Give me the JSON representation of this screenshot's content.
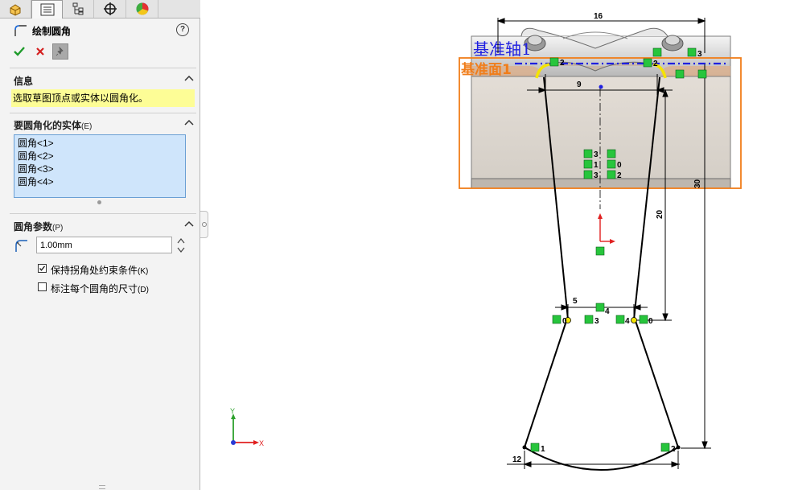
{
  "property_manager": {
    "title": "绘制圆角",
    "help_symbol": "?",
    "info_section": {
      "heading": "信息",
      "message": "选取草图顶点或实体以圆角化。"
    },
    "entities_section": {
      "heading": "要圆角化的实体",
      "hotkey": "(E)",
      "items": [
        "圆角<1>",
        "圆角<2>",
        "圆角<3>",
        "圆角<4>"
      ]
    },
    "params_section": {
      "heading": "圆角参数",
      "hotkey": "(P)",
      "radius_value": "1.00mm",
      "keep_constraints": {
        "label": "保持拐角处约束条件",
        "hotkey": "(K)",
        "checked": true
      },
      "dimension_each": {
        "label": "标注每个圆角的尺寸",
        "hotkey": "(D)",
        "checked": false
      }
    },
    "tabs": [
      "feature-manager-icon",
      "property-manager-icon",
      "configuration-manager-icon",
      "dimxpert-icon",
      "display-manager-icon"
    ]
  },
  "viewport": {
    "axis_label": "基准轴1",
    "plane_label": "基准面1",
    "dimensions": {
      "top_width": "16",
      "inner_width": "9",
      "height": "20",
      "neck_width": "5",
      "depth": "30",
      "bottom_offset": "12"
    },
    "relation_tags": [
      "2",
      "3",
      "2",
      "0",
      "1",
      "0",
      "3",
      "2",
      "4",
      "0",
      "4",
      "3",
      "0",
      "1",
      "2",
      "3"
    ],
    "triad": {
      "x": "X",
      "y": "Y"
    },
    "colors": {
      "sketch": "#000000",
      "plane_border": "#f07d1a",
      "axis": "#1f1fe0",
      "relation_fill": "#27c53c",
      "fillet_highlight": "#f5e400"
    }
  }
}
